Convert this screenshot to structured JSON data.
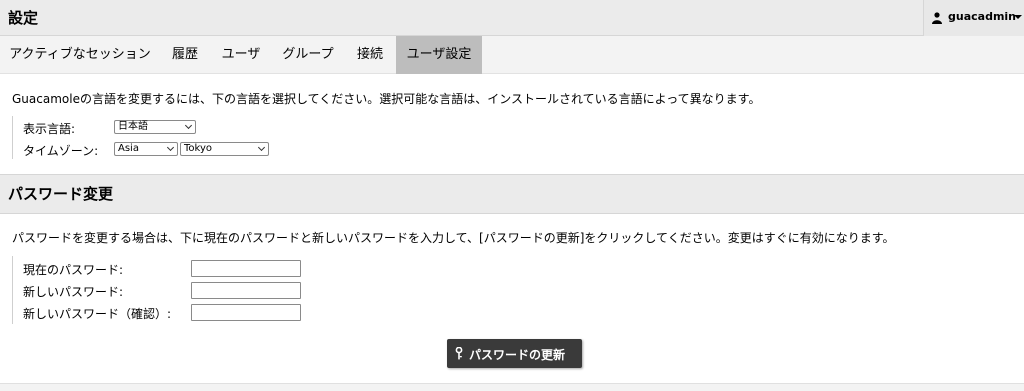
{
  "header": {
    "title": "設定",
    "user": "guacadmin",
    "user_icon": "user-icon",
    "menu_icon": "caret-down-icon"
  },
  "tabs": [
    {
      "label": "アクティブなセッション",
      "active": false
    },
    {
      "label": "履歴",
      "active": false
    },
    {
      "label": "ユーザ",
      "active": false
    },
    {
      "label": "グループ",
      "active": false
    },
    {
      "label": "接続",
      "active": false
    },
    {
      "label": "ユーザ設定",
      "active": true
    }
  ],
  "preferences": {
    "note": "Guacamoleの言語を変更するには、下の言語を選択してください。選択可能な言語は、インストールされている言語によって異なります。",
    "language_label": "表示言語:",
    "language_value": "日本語",
    "timezone_label": "タイムゾーン:",
    "timezone_region": "Asia",
    "timezone_city": "Tokyo"
  },
  "password": {
    "section_title": "パスワード変更",
    "note": "パスワードを変更する場合は、下に現在のパスワードと新しいパスワードを入力して、[パスワードの更新]をクリックしてください。変更はすぐに有効になります。",
    "current_label": "現在のパスワード:",
    "new_label": "新しいパスワード:",
    "confirm_label": "新しいパスワード（確認）:",
    "current_value": "",
    "new_value": "",
    "confirm_value": "",
    "update_button": "パスワードの更新",
    "button_icon": "key-icon"
  },
  "colors": {
    "header_bg": "#ebebeb",
    "active_tab_bg": "#bdbdbd",
    "button_bg": "#3a3a3a"
  }
}
